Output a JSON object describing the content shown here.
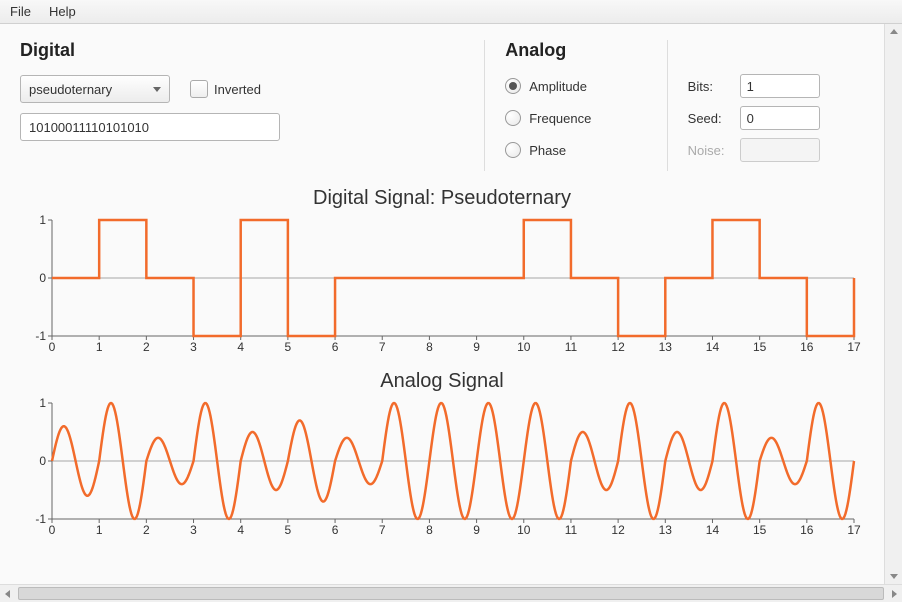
{
  "menu": {
    "file": "File",
    "help": "Help"
  },
  "digital": {
    "title": "Digital",
    "encoding_selected": "pseudoternary",
    "inverted_label": "Inverted",
    "inverted_checked": false,
    "bitstring": "10100011110101010"
  },
  "analog": {
    "title": "Analog",
    "modes": {
      "amplitude": {
        "label": "Amplitude",
        "checked": true
      },
      "frequence": {
        "label": "Frequence",
        "checked": false
      },
      "phase": {
        "label": "Phase",
        "checked": false
      }
    },
    "bits_label": "Bits:",
    "bits_value": "1",
    "seed_label": "Seed:",
    "seed_value": "0",
    "noise_label": "Noise:",
    "noise_value": ""
  },
  "chart_data": [
    {
      "type": "line",
      "title": "Digital Signal: Pseudoternary",
      "xlabel": "",
      "ylabel": "",
      "xlim": [
        0,
        17
      ],
      "ylim": [
        -1,
        1
      ],
      "xticks": [
        0,
        1,
        2,
        3,
        4,
        5,
        6,
        7,
        8,
        9,
        10,
        11,
        12,
        13,
        14,
        15,
        16,
        17
      ],
      "yticks": [
        -1,
        0,
        1
      ],
      "x": [
        0,
        1,
        1,
        2,
        2,
        3,
        3,
        4,
        4,
        5,
        5,
        6,
        6,
        10,
        10,
        11,
        11,
        12,
        12,
        13,
        13,
        14,
        14,
        15,
        15,
        16,
        16,
        17,
        17
      ],
      "values": [
        0,
        0,
        1,
        1,
        0,
        0,
        -1,
        -1,
        1,
        1,
        -1,
        -1,
        0,
        0,
        1,
        1,
        0,
        0,
        -1,
        -1,
        0,
        0,
        1,
        1,
        0,
        0,
        -1,
        -1,
        0
      ],
      "color": "#f26b2b"
    },
    {
      "type": "line",
      "title": "Analog Signal",
      "xlabel": "",
      "ylabel": "",
      "xlim": [
        0,
        17
      ],
      "ylim": [
        -1,
        1
      ],
      "xticks": [
        0,
        1,
        2,
        3,
        4,
        5,
        6,
        7,
        8,
        9,
        10,
        11,
        12,
        13,
        14,
        15,
        16,
        17
      ],
      "yticks": [
        -1,
        0,
        1
      ],
      "description": "Amplitude-modulated sine carrier; amplitude envelope varies roughly between 0.3 and 1.0 across bit intervals",
      "bit_amplitudes": [
        0.6,
        1.0,
        0.4,
        1.0,
        0.5,
        0.7,
        0.4,
        1.0,
        1.0,
        1.0,
        1.0,
        0.5,
        1.0,
        0.5,
        1.0,
        0.4,
        1.0
      ],
      "carrier_cycles_per_bit": 1,
      "color": "#f26b2b"
    }
  ]
}
